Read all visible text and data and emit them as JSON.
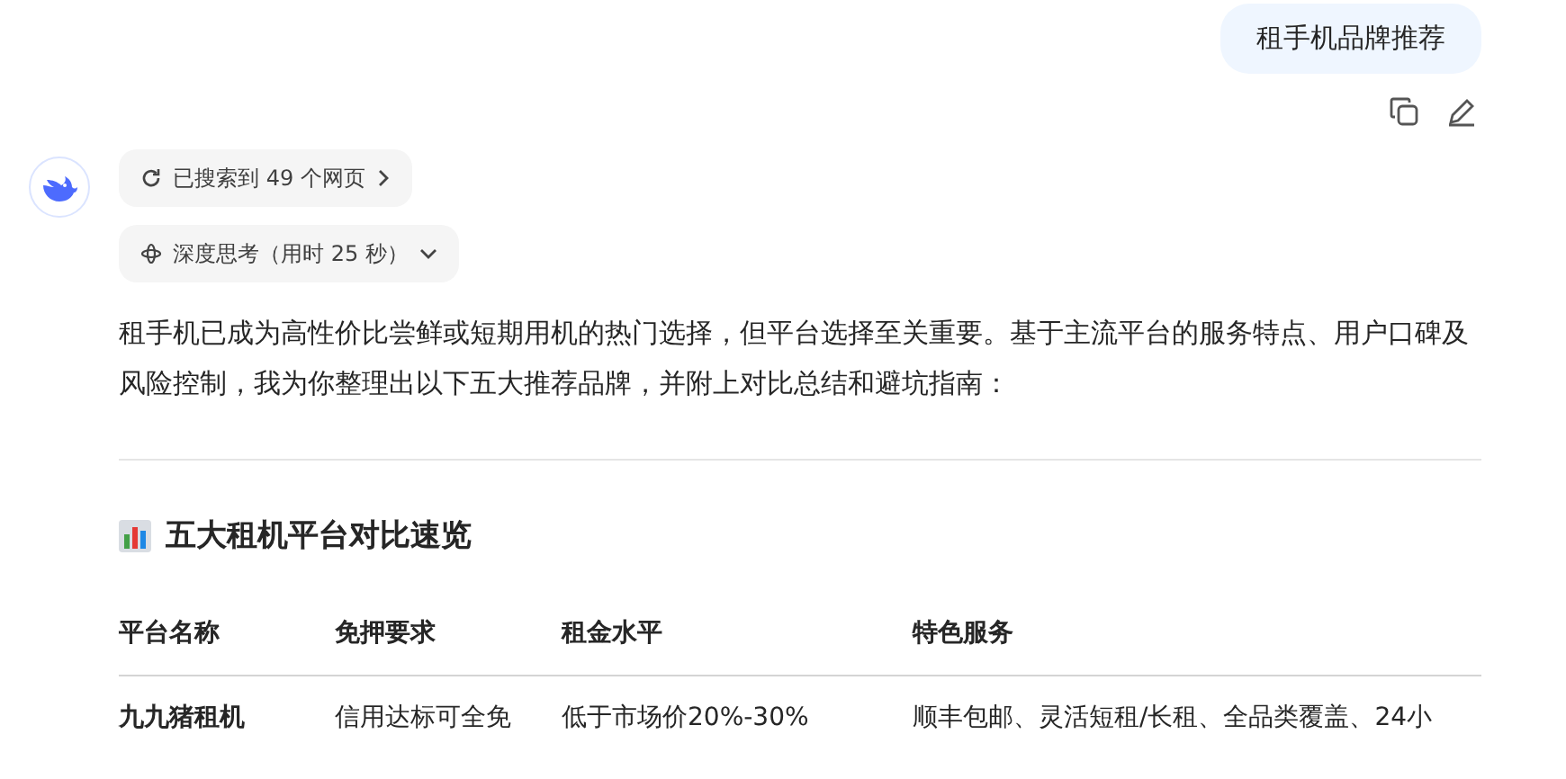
{
  "user_message": {
    "text": "租手机品牌推荐"
  },
  "assistant": {
    "search_pill": {
      "text": "已搜索到 49 个网页"
    },
    "thinking_pill": {
      "text": "深度思考（用时 25 秒）",
      "expanded": false
    },
    "intro": "租手机已成为高性价比尝鲜或短期用机的热门选择，但平台选择至关重要。基于主流平台的服务特点、用户口碑及风险控制，我为你整理出以下五大推荐品牌，并附上对比总结和避坑指南：",
    "section_title": "五大租机平台对比速览",
    "table": {
      "columns": [
        "平台名称",
        "免押要求",
        "租金水平",
        "特色服务"
      ],
      "rows": [
        [
          "九九猪租机",
          "信用达标可全免",
          "低于市场价20%-30%",
          "顺丰包邮、灵活短租/长租、全品类覆盖、24小"
        ]
      ]
    }
  }
}
